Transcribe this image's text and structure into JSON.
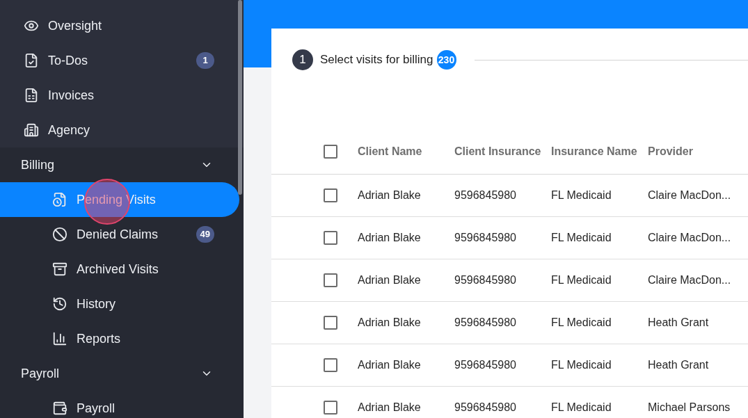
{
  "sidebar": {
    "items": [
      {
        "label": "Oversight",
        "selected": false
      },
      {
        "label": "To-Dos",
        "badge": "1",
        "selected": false
      },
      {
        "label": "Invoices",
        "selected": false
      },
      {
        "label": "Agency",
        "selected": false
      }
    ],
    "sections": [
      {
        "label": "Billing",
        "expanded": true,
        "children": [
          {
            "label": "Pending Visits",
            "selected": true
          },
          {
            "label": "Denied Claims",
            "badge": "49",
            "selected": false
          },
          {
            "label": "Archived Visits",
            "selected": false
          },
          {
            "label": "History",
            "selected": false
          },
          {
            "label": "Reports",
            "selected": false
          }
        ]
      },
      {
        "label": "Payroll",
        "expanded": true,
        "children": [
          {
            "label": "Payroll",
            "selected": false
          }
        ]
      }
    ]
  },
  "stepper": {
    "step": "1",
    "title": "Select visits for billing",
    "count": "230"
  },
  "table": {
    "columns": [
      "Client Name",
      "Client Insurance",
      "Insurance Name",
      "Provider"
    ],
    "all_checked": false,
    "rows": [
      {
        "checked": false,
        "cells": [
          "Adrian Blake",
          "9596845980",
          "FL Medicaid",
          "Claire MacDon..."
        ]
      },
      {
        "checked": false,
        "cells": [
          "Adrian Blake",
          "9596845980",
          "FL Medicaid",
          "Claire MacDon..."
        ]
      },
      {
        "checked": false,
        "cells": [
          "Adrian Blake",
          "9596845980",
          "FL Medicaid",
          "Claire MacDon..."
        ]
      },
      {
        "checked": false,
        "cells": [
          "Adrian Blake",
          "9596845980",
          "FL Medicaid",
          "Heath Grant"
        ]
      },
      {
        "checked": false,
        "cells": [
          "Adrian Blake",
          "9596845980",
          "FL Medicaid",
          "Heath Grant"
        ]
      },
      {
        "checked": false,
        "cells": [
          "Adrian Blake",
          "9596845980",
          "FL Medicaid",
          "Michael Parsons"
        ]
      }
    ]
  }
}
